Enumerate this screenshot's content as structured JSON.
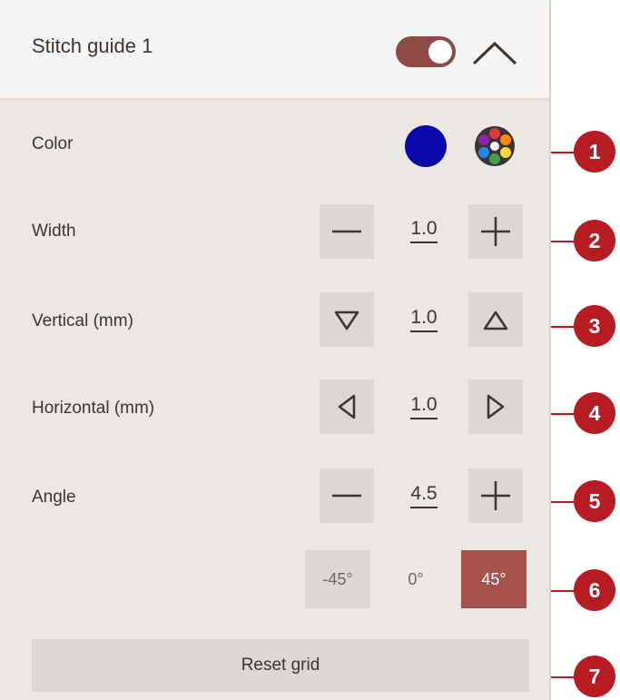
{
  "header": {
    "title": "Stitch guide 1",
    "toggle_on": true
  },
  "rows": {
    "color": {
      "label": "Color",
      "current_color": "#0a0aaa"
    },
    "width": {
      "label": "Width",
      "value": "1.0"
    },
    "vertical": {
      "label": "Vertical (mm)",
      "value": "1.0"
    },
    "horizontal": {
      "label": "Horizontal (mm)",
      "value": "1.0"
    },
    "angle": {
      "label": "Angle",
      "value": "4.5"
    }
  },
  "angle_presets": [
    "-45°",
    "0°",
    "45°"
  ],
  "angle_preset_selected": "45°",
  "reset_label": "Reset grid",
  "callouts": [
    "1",
    "2",
    "3",
    "4",
    "5",
    "6",
    "7"
  ],
  "colors": {
    "accent": "#a4524b",
    "toggle": "#8e4a45",
    "callout": "#b71c22",
    "panel": "#ebe7e3",
    "button": "#dcd7d2"
  }
}
